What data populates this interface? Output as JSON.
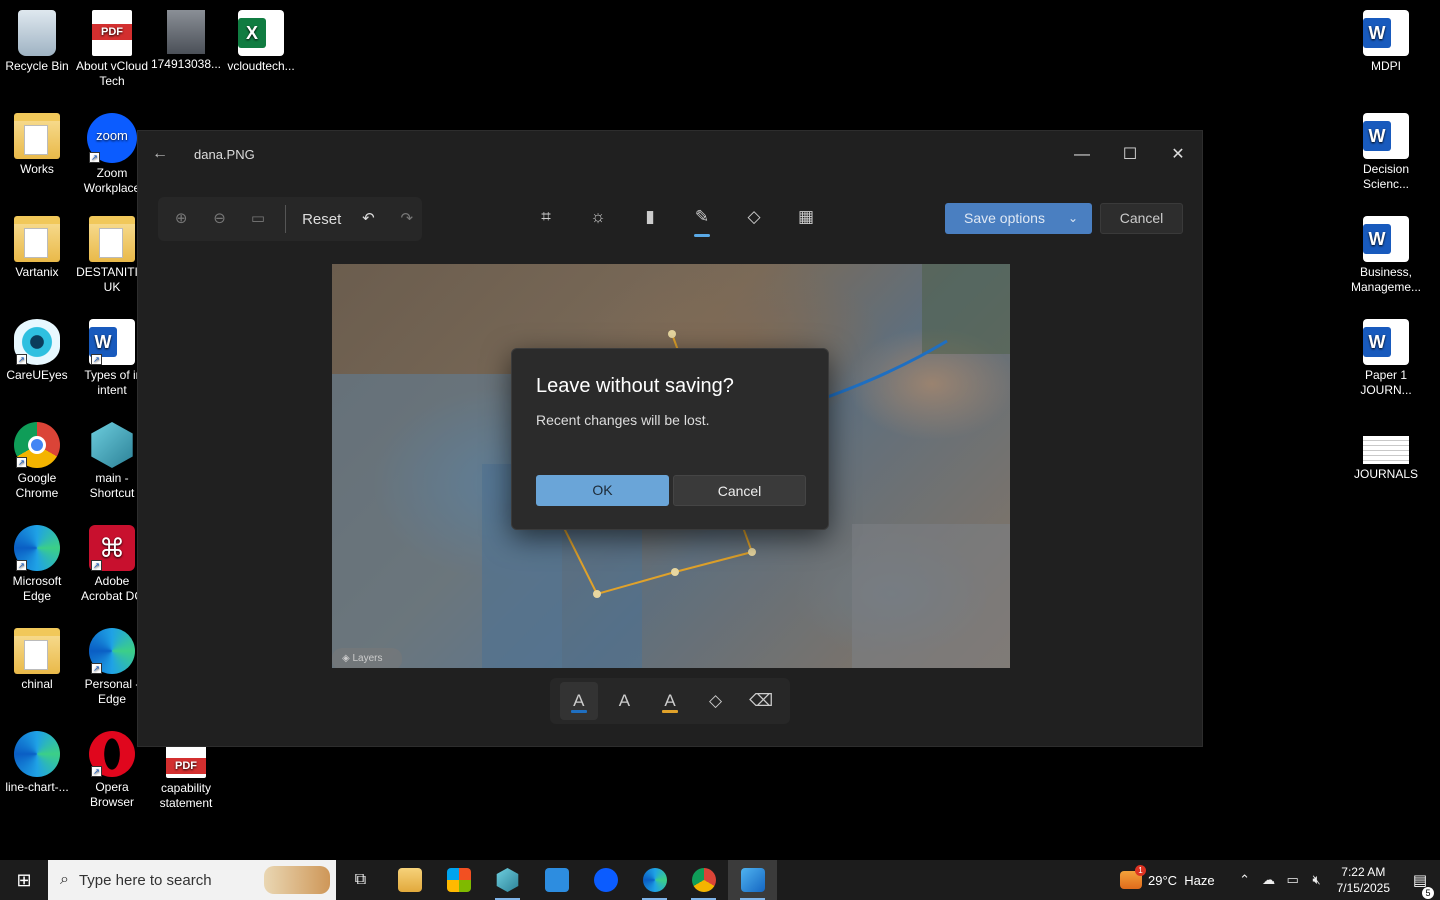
{
  "desktop": {
    "icons": [
      {
        "label": "Recycle Bin"
      },
      {
        "label": "About vCloud Tech"
      },
      {
        "label": "174913038..."
      },
      {
        "label": "vcloudtech..."
      },
      {
        "label": "Works"
      },
      {
        "label": "Zoom Workplace"
      },
      {
        "label": "Vartanix"
      },
      {
        "label": "DESTANITI... UK"
      },
      {
        "label": "CareUEyes"
      },
      {
        "label": "Types of ir intent"
      },
      {
        "label": "Google Chrome"
      },
      {
        "label": "main - Shortcut"
      },
      {
        "label": "Microsoft Edge"
      },
      {
        "label": "Adobe Acrobat DC"
      },
      {
        "label": "chinal"
      },
      {
        "label": "Personal - Edge"
      },
      {
        "label": "line-chart-..."
      },
      {
        "label": "Opera Browser"
      },
      {
        "label": "capability statement"
      },
      {
        "label": "MDPI"
      },
      {
        "label": "Decision Scienc..."
      },
      {
        "label": "Business, Manageme..."
      },
      {
        "label": "Paper 1 JOURN..."
      },
      {
        "label": "JOURNALS"
      }
    ]
  },
  "window": {
    "title": "dana.PNG",
    "toolbar": {
      "reset_label": "Reset",
      "save_options_label": "Save options",
      "cancel_label": "Cancel"
    },
    "canvas": {
      "layers_label": "Layers"
    }
  },
  "dialog": {
    "title": "Leave without saving?",
    "message": "Recent changes will be lost.",
    "ok_label": "OK",
    "cancel_label": "Cancel"
  },
  "taskbar": {
    "search_placeholder": "Type here to search",
    "weather": "29°C  Haze",
    "weather_badge": "1",
    "time": "7:22 AM",
    "date": "7/15/2025",
    "notification_count": "5"
  },
  "colors": {
    "accent": "#4a7fc1",
    "dialog_ok": "#6aa5d8",
    "selection_outline": "#e0a22a",
    "pen_stroke": "#1f6fc1"
  }
}
